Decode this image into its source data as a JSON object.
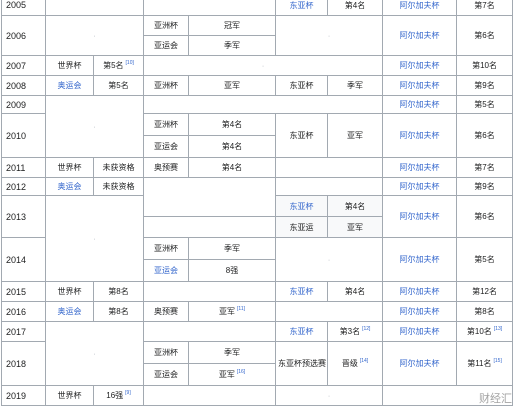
{
  "rows": {
    "r2005": {
      "year": "2005",
      "eac": "东亚杯",
      "eac_res": "第4名",
      "gulf": "阿尔加夫杯",
      "gulf_res": "第7名"
    },
    "r2006": {
      "year": "2006",
      "a1": "亚洲杯",
      "a1_res": "冠军",
      "a2": "亚运会",
      "a2_res": "季军",
      "gulf": "阿尔加夫杯",
      "gulf_res": "第6名"
    },
    "r2007": {
      "year": "2007",
      "wc": "世界杯",
      "wc_res": "第5名",
      "ref": "[10]",
      "gulf": "阿尔加夫杯",
      "gulf_res": "第10名"
    },
    "r2008": {
      "year": "2008",
      "olym": "奥运会",
      "olym_res": "第5名",
      "a1": "亚洲杯",
      "a1_res": "亚军",
      "eac": "东亚杯",
      "eac_res": "季军",
      "gulf": "阿尔加夫杯",
      "gulf_res": "第9名"
    },
    "r2009": {
      "year": "2009",
      "gulf": "阿尔加夫杯",
      "gulf_res": "第5名"
    },
    "r2010": {
      "year": "2010",
      "a1": "亚洲杯",
      "a1_res": "第4名",
      "a2": "亚运会",
      "a2_res": "第4名",
      "eac": "东亚杯",
      "eac_res": "亚军",
      "gulf": "阿尔加夫杯",
      "gulf_res": "第6名"
    },
    "r2011": {
      "year": "2011",
      "wc": "世界杯",
      "wc_res": "未获资格",
      "oq": "奥预赛",
      "oq_res": "第4名",
      "gulf": "阿尔加夫杯",
      "gulf_res": "第7名"
    },
    "r2012": {
      "year": "2012",
      "olym": "奥运会",
      "olym_res": "未获资格",
      "gulf": "阿尔加夫杯",
      "gulf_res": "第9名"
    },
    "r2013": {
      "year": "2013",
      "eac": "东亚杯",
      "eac_res": "第4名",
      "eag": "东亚运",
      "eag_res": "亚军",
      "gulf": "阿尔加夫杯",
      "gulf_res": "第6名"
    },
    "r2014": {
      "year": "2014",
      "a1": "亚洲杯",
      "a1_res": "季军",
      "a2": "亚运会",
      "a2_res": "8强",
      "gulf": "阿尔加夫杯",
      "gulf_res": "第5名"
    },
    "r2015": {
      "year": "2015",
      "wc": "世界杯",
      "wc_res": "第8名",
      "eac": "东亚杯",
      "eac_res": "第4名",
      "gulf": "阿尔加夫杯",
      "gulf_res": "第12名"
    },
    "r2016": {
      "year": "2016",
      "olym": "奥运会",
      "olym_res": "第8名",
      "oq": "奥预赛",
      "oq_res": "亚军",
      "ref": "[11]",
      "gulf": "阿尔加夫杯",
      "gulf_res": "第8名"
    },
    "r2017": {
      "year": "2017",
      "eac": "东亚杯",
      "eac_res": "第3名",
      "ref1": "[12]",
      "gulf": "阿尔加夫杯",
      "gulf_res": "第10名",
      "ref2": "[13]"
    },
    "r2018": {
      "year": "2018",
      "a1": "亚洲杯",
      "a1_res": "季军",
      "a2": "亚运会",
      "a2_res": "亚军",
      "ref": "[16]",
      "eacq": "东亚杯预选赛",
      "eacq_res": "晋级",
      "ref2": "[14]",
      "gulf": "阿尔加夫杯",
      "gulf_res": "第11名",
      "ref3": "[15]"
    },
    "r2019": {
      "year": "2019",
      "wc": "世界杯",
      "wc_res": "16强",
      "ref": "[9]"
    }
  },
  "placeholder_dot": "·",
  "watermark": "财经汇",
  "colors": {
    "link": "#3366cc",
    "border": "#a2a9b1",
    "text": "#202122"
  }
}
